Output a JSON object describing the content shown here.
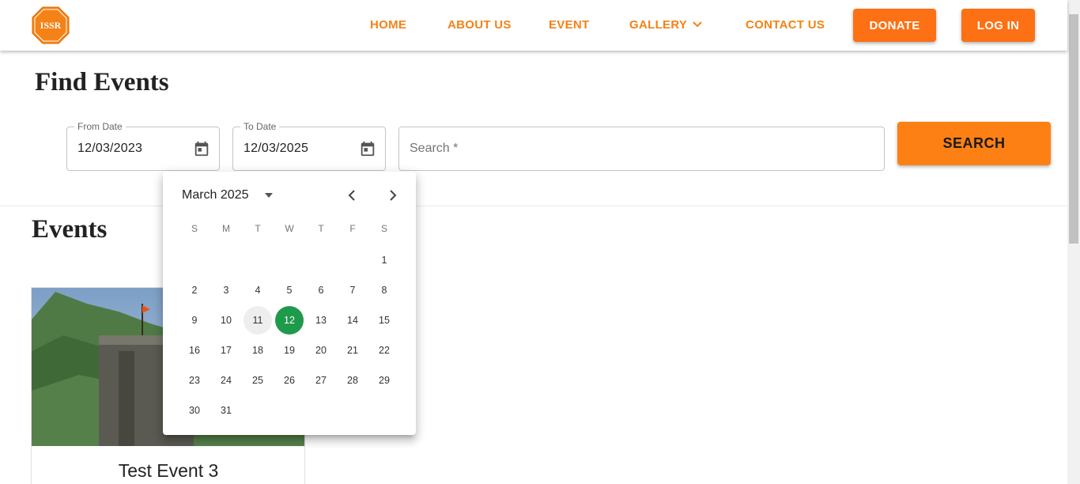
{
  "brand": {
    "logo_text": "ISSR",
    "accent": "#f58216",
    "button_color": "#fd7014"
  },
  "nav": {
    "home": "HOME",
    "about": "ABOUT US",
    "event": "EVENT",
    "gallery": "GALLERY",
    "contact": "CONTACT US",
    "donate": "DONATE",
    "login": "LOG IN"
  },
  "find_events": {
    "title": "Find Events",
    "from_date": {
      "label": "From Date",
      "value": "12/03/2023"
    },
    "to_date": {
      "label": "To Date",
      "value": "12/03/2025"
    },
    "search": {
      "placeholder": "Search *"
    },
    "search_button": "SEARCH"
  },
  "events": {
    "title": "Events",
    "cards": [
      {
        "title": "Test Event 3"
      }
    ]
  },
  "calendar": {
    "month_label": "March 2025",
    "weekdays": [
      "S",
      "M",
      "T",
      "W",
      "T",
      "F",
      "S"
    ],
    "first_weekday_index": 6,
    "days_in_month": 31,
    "today": 11,
    "selected": 12,
    "selected_color": "#1e9a4b"
  }
}
